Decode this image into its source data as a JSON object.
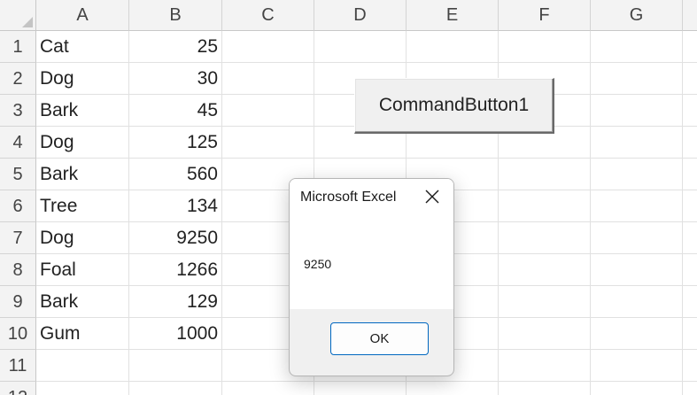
{
  "columns": [
    "A",
    "B",
    "C",
    "D",
    "E",
    "F",
    "G"
  ],
  "rows": [
    "1",
    "2",
    "3",
    "4",
    "5",
    "6",
    "7",
    "8",
    "9",
    "10",
    "11",
    "12"
  ],
  "cells": [
    [
      "Cat",
      "25"
    ],
    [
      "Dog",
      "30"
    ],
    [
      "Bark",
      "45"
    ],
    [
      "Dog",
      "125"
    ],
    [
      "Bark",
      "560"
    ],
    [
      "Tree",
      "134"
    ],
    [
      "Dog",
      "9250"
    ],
    [
      "Foal",
      "1266"
    ],
    [
      "Bark",
      "129"
    ],
    [
      "Gum",
      "1000"
    ],
    [
      "",
      ""
    ],
    [
      "",
      ""
    ]
  ],
  "command_button": {
    "label": "CommandButton1"
  },
  "msgbox": {
    "title": "Microsoft Excel",
    "message": "9250",
    "ok_label": "OK",
    "close_icon": "close-icon"
  },
  "colors": {
    "header_bg": "#f3f3f3",
    "gridline": "#e1e1e1",
    "ok_border": "#0067c0"
  }
}
